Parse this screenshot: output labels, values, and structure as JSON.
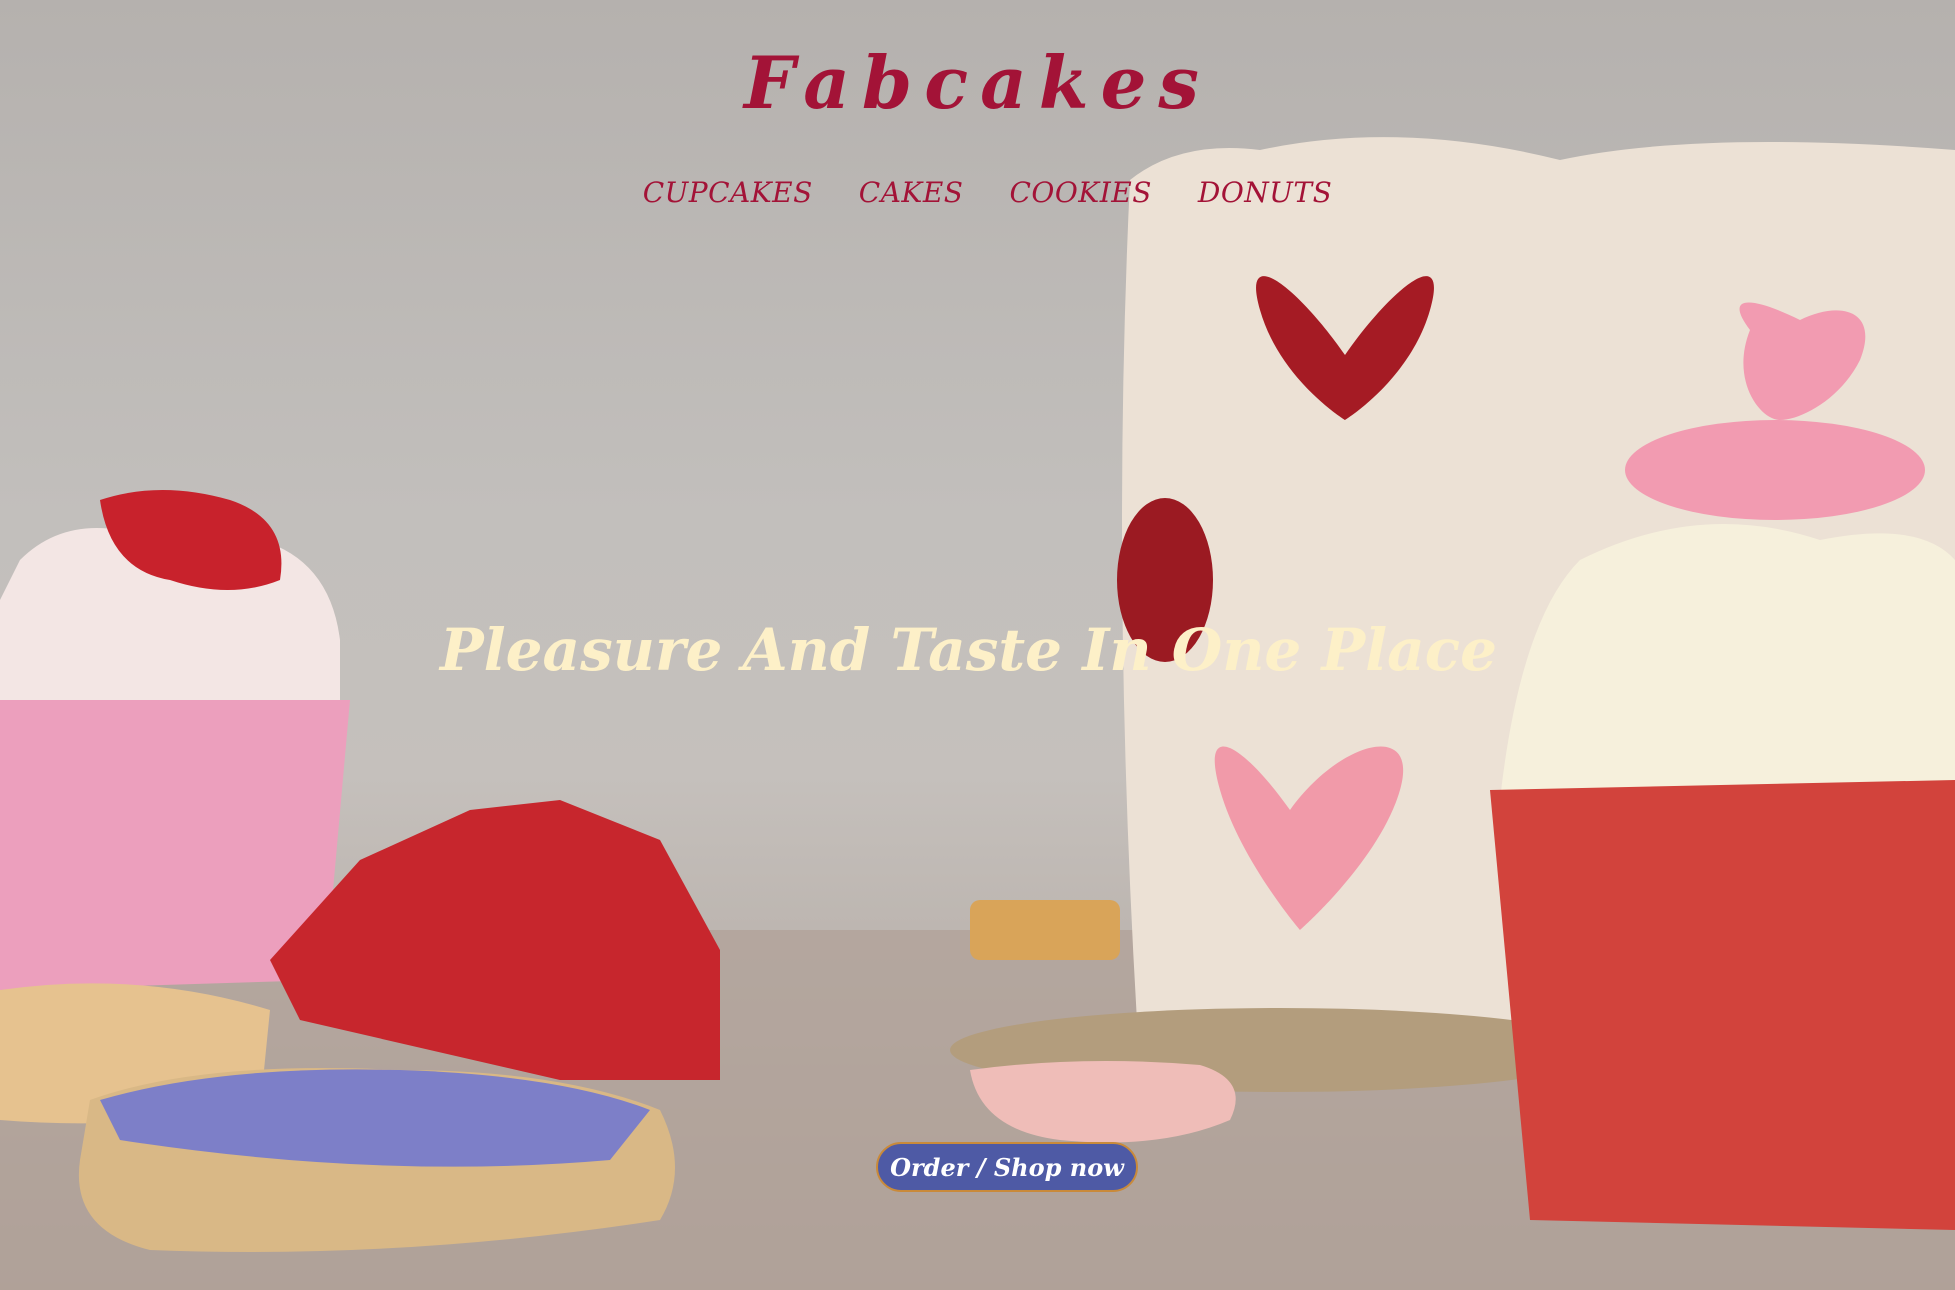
{
  "brand": {
    "name": "Fabcakes",
    "color": "#a31337"
  },
  "nav": {
    "items": [
      "CUPCAKES",
      "CAKES",
      "COOKIES",
      "DONUTS"
    ]
  },
  "hero": {
    "tagline": "Pleasure And Taste In One Place",
    "tagline_color": "#fdf0c8",
    "background": "photo of valentine cakes, cupcakes and cookies"
  },
  "cta": {
    "label": "Order / Shop now",
    "color": "#4e5aa5"
  }
}
